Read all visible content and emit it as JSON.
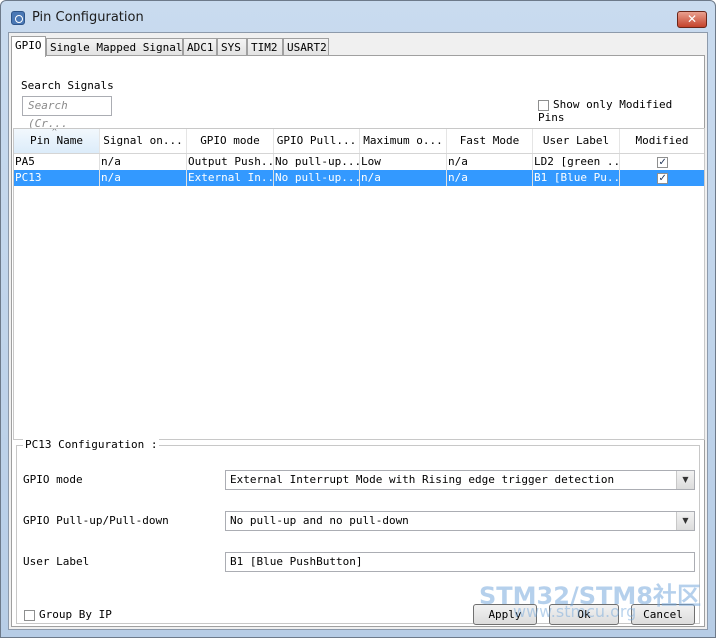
{
  "window": {
    "title": "Pin Configuration",
    "close_glyph": "✕"
  },
  "tabs": [
    {
      "label": "GPIO"
    },
    {
      "label": "Single Mapped Signals"
    },
    {
      "label": "ADC1"
    },
    {
      "label": "SYS"
    },
    {
      "label": "TIM2"
    },
    {
      "label": "USART2"
    }
  ],
  "search": {
    "label": "Search Signals",
    "placeholder": "Search (Cr..."
  },
  "show_modified": {
    "label": "Show only Modified Pins",
    "checked": false
  },
  "table": {
    "columns": [
      "Pin Name",
      "Signal on...",
      "GPIO mode",
      "GPIO Pull...",
      "Maximum o...",
      "Fast Mode",
      "User Label",
      "Modified"
    ],
    "sorted_column": "Pin Name",
    "rows": [
      {
        "pin": "PA5",
        "signal": "n/a",
        "mode": "Output Push...",
        "pull": "No pull-up...",
        "maximum": "Low",
        "fast": "n/a",
        "label": "LD2 [green ...",
        "modified": true,
        "selected": false
      },
      {
        "pin": "PC13",
        "signal": "n/a",
        "mode": "External In...",
        "pull": "No pull-up...",
        "maximum": "n/a",
        "fast": "n/a",
        "label": "B1 [Blue Pu...",
        "modified": true,
        "selected": true
      }
    ]
  },
  "config": {
    "title": "PC13 Configuration :",
    "gpio_mode_label": "GPIO mode",
    "gpio_mode_value": "External Interrupt Mode with Rising edge trigger detection",
    "pull_label": "GPIO Pull-up/Pull-down",
    "pull_value": "No pull-up and no pull-down",
    "user_label_label": "User Label",
    "user_label_value": "B1 [Blue PushButton]"
  },
  "group_by_ip": {
    "label": "Group By IP",
    "checked": false
  },
  "buttons": {
    "apply": "Apply",
    "ok": "Ok",
    "cancel": "Cancel"
  },
  "watermark": {
    "line1": "STM32/STM8社区",
    "line2": "www.stmcu.org"
  },
  "icons": {
    "dropdown": "▼",
    "sort": "^"
  },
  "colors": {
    "selection": "#3399ff",
    "close": "#c4422b"
  }
}
